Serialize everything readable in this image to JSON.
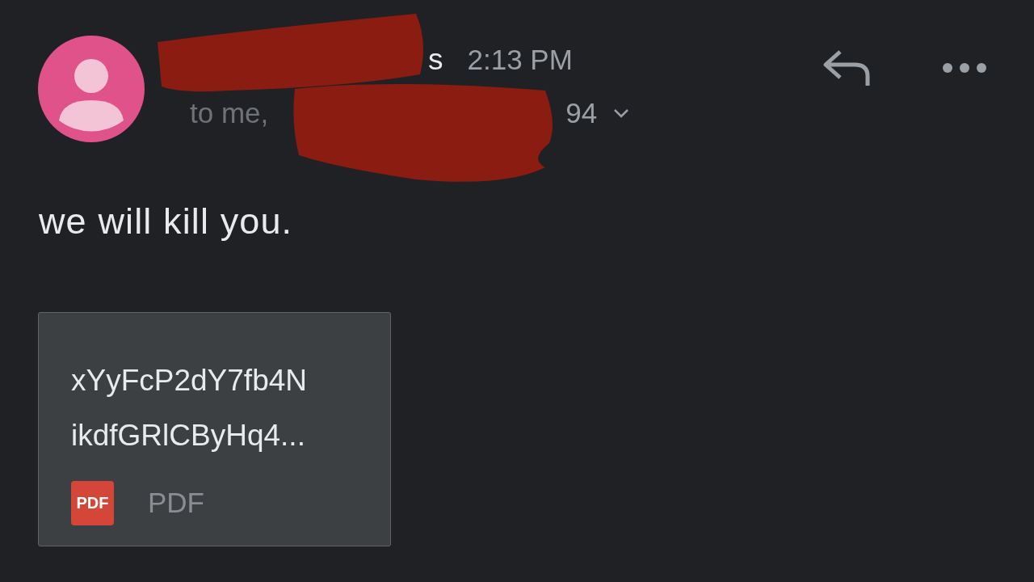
{
  "message": {
    "sender_fragment": "s",
    "time": "2:13 PM",
    "recipients_fragment": "to me,",
    "recipients_tail": "94",
    "body": "we will kill you."
  },
  "attachment": {
    "name_lines": [
      "xYyFcP2dY7fb4N",
      "ikdfGRlCByHq4..."
    ],
    "file_type": "PDF",
    "icon_label": "PDF"
  }
}
